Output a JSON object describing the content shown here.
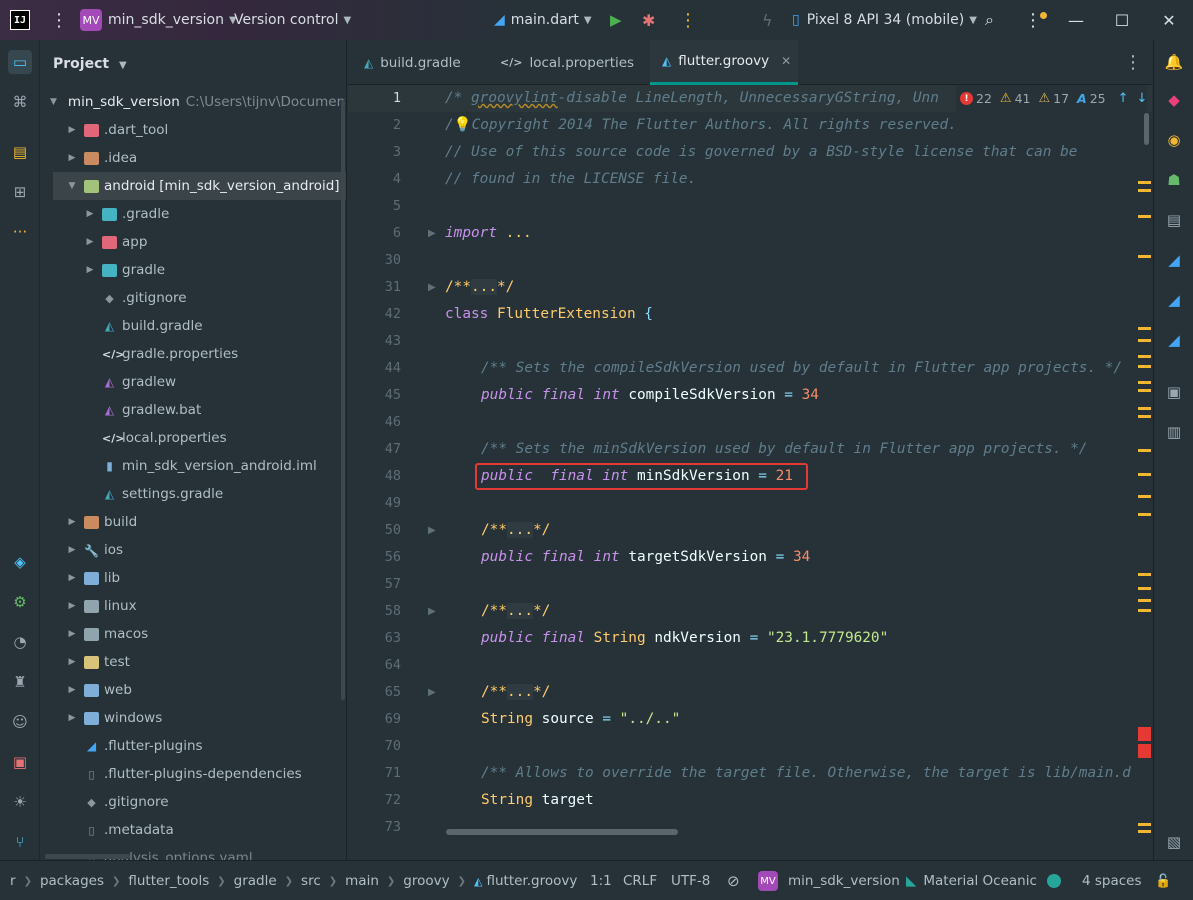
{
  "titlebar": {
    "app_logo": "IJ",
    "project_badge": "MV",
    "project_name": "min_sdk_version",
    "vcs_label": "Version control",
    "run_config": "main.dart",
    "device": "Pixel 8 API 34 (mobile)"
  },
  "project_panel": {
    "title": "Project",
    "root_name": "min_sdk_version",
    "root_path": "C:\\Users\\tijnv\\Document",
    "items": [
      {
        "label": ".dart_tool"
      },
      {
        "label": ".idea"
      },
      {
        "label": "android",
        "suffix": "[min_sdk_version_android]"
      },
      {
        "label": ".gradle"
      },
      {
        "label": "app"
      },
      {
        "label": "gradle"
      },
      {
        "label": ".gitignore"
      },
      {
        "label": "build.gradle"
      },
      {
        "label": "gradle.properties"
      },
      {
        "label": "gradlew"
      },
      {
        "label": "gradlew.bat"
      },
      {
        "label": "local.properties"
      },
      {
        "label": "min_sdk_version_android.iml"
      },
      {
        "label": "settings.gradle"
      },
      {
        "label": "build"
      },
      {
        "label": "ios"
      },
      {
        "label": "lib"
      },
      {
        "label": "linux"
      },
      {
        "label": "macos"
      },
      {
        "label": "test"
      },
      {
        "label": "web"
      },
      {
        "label": "windows"
      },
      {
        "label": ".flutter-plugins"
      },
      {
        "label": ".flutter-plugins-dependencies"
      },
      {
        "label": ".gitignore"
      },
      {
        "label": ".metadata"
      },
      {
        "label": "analysis_options.yaml"
      }
    ]
  },
  "tabs": [
    {
      "label": "build.gradle"
    },
    {
      "label": "local.properties"
    },
    {
      "label": "flutter.groovy"
    }
  ],
  "inspections": {
    "errors": "22",
    "warnings": "41",
    "weak_warnings": "17",
    "typos": "25"
  },
  "editor": {
    "lines": [
      {
        "num": "1"
      },
      {
        "num": "2"
      },
      {
        "num": "3"
      },
      {
        "num": "4"
      },
      {
        "num": "5"
      },
      {
        "num": "6"
      },
      {
        "num": "30"
      },
      {
        "num": "31"
      },
      {
        "num": "42"
      },
      {
        "num": "43"
      },
      {
        "num": "44"
      },
      {
        "num": "45"
      },
      {
        "num": "46"
      },
      {
        "num": "47"
      },
      {
        "num": "48"
      },
      {
        "num": "49"
      },
      {
        "num": "50"
      },
      {
        "num": "56"
      },
      {
        "num": "57"
      },
      {
        "num": "58"
      },
      {
        "num": "63"
      },
      {
        "num": "64"
      },
      {
        "num": "65"
      },
      {
        "num": "69"
      },
      {
        "num": "70"
      },
      {
        "num": "71"
      },
      {
        "num": "72"
      },
      {
        "num": "73"
      }
    ],
    "code": {
      "l1_a": "/* ",
      "l1_b": "groovylint",
      "l1_c": "-disable LineLength, UnnecessaryGString, Unn",
      "l2": "Copyright 2014 The Flutter Authors. All rights reserved.",
      "l3": "// Use of this source code is governed by a BSD-style license that can be",
      "l4": "// found in the LICENSE file.",
      "import_kw": "import",
      "fold_dots": "...",
      "doc_open": "/**",
      "doc_close": "*/",
      "class_kw": "class",
      "class_name": "FlutterExtension",
      "brace": "{",
      "c44": "/** Sets the compileSdkVersion used by default in Flutter app projects. */",
      "public": "public",
      "final": "final",
      "int": "int",
      "compile_name": "compileSdkVersion",
      "eq": "=",
      "v34": "34",
      "c47": "/** Sets the minSdkVersion used by default in Flutter app projects. */",
      "min_name": "minSdkVersion",
      "v21": "21",
      "target_name": "targetSdkVersion",
      "string_type": "String",
      "ndk_name": "ndkVersion",
      "ndk_val": "\"23.1.7779620\"",
      "source_name": "source",
      "source_val": "\"../..\"",
      "c71": "/** Allows to override the target file. Otherwise, the target is lib/main.d",
      "target_field": "target"
    }
  },
  "statusbar": {
    "breadcrumbs": [
      "r",
      "packages",
      "flutter_tools",
      "gradle",
      "src",
      "main",
      "groovy",
      "flutter.groovy"
    ],
    "position": "1:1",
    "line_sep": "CRLF",
    "encoding": "UTF-8",
    "project_badge": "MV",
    "project_name": "min_sdk_version",
    "theme": "Material Oceanic",
    "indent": "4 spaces"
  }
}
